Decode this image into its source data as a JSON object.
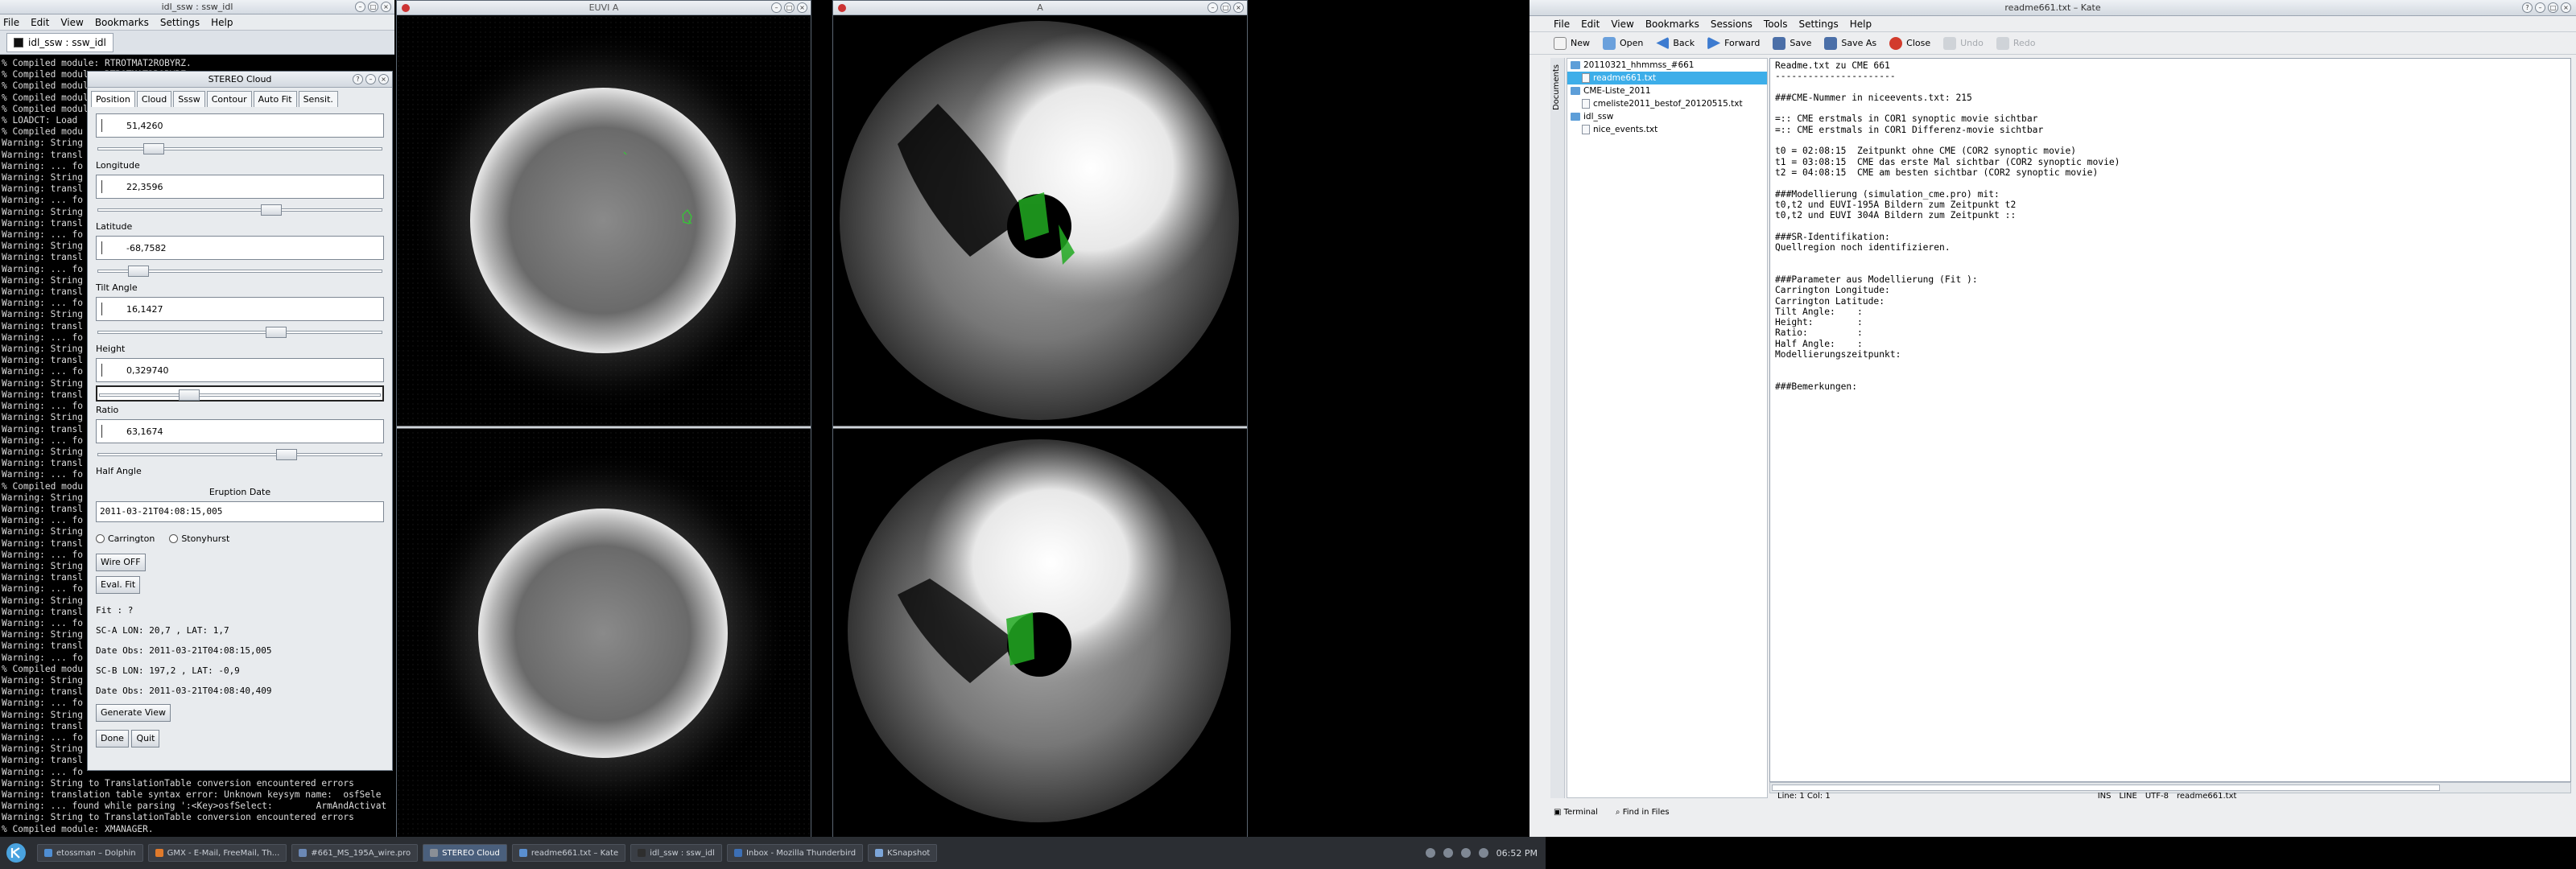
{
  "terminal": {
    "title": "idl_ssw : ssw_idl",
    "menu": [
      "File",
      "Edit",
      "View",
      "Bookmarks",
      "Settings",
      "Help"
    ],
    "tab_label": "idl_ssw : ssw_idl",
    "lines": [
      "% Compiled module: RTROTMAT2ROBYRZ.",
      "% Compiled module: RTROTMAT2ROBYRZ.",
      "% Compiled module: ",
      "% Compiled module: ",
      "% Compiled module: ",
      "% LOADCT: Load",
      "% Compiled modu",
      "Warning: String",
      "Warning: transl",
      "Warning: ... fo",
      "Warning: String",
      "Warning: transl",
      "Warning: ... fo",
      "Warning: String",
      "Warning: transl",
      "Warning: ... fo",
      "Warning: String",
      "Warning: transl",
      "Warning: ... fo",
      "Warning: String",
      "Warning: transl",
      "Warning: ... fo",
      "Warning: String",
      "Warning: transl",
      "Warning: ... fo",
      "Warning: String",
      "Warning: transl",
      "Warning: ... fo",
      "Warning: String",
      "Warning: transl",
      "Warning: ... fo",
      "Warning: String",
      "Warning: transl",
      "Warning: ... fo",
      "Warning: String",
      "Warning: transl",
      "Warning: ... fo",
      "% Compiled modu",
      "Warning: String",
      "Warning: transl",
      "Warning: ... fo",
      "Warning: String",
      "Warning: transl",
      "Warning: ... fo",
      "Warning: String",
      "Warning: transl",
      "Warning: ... fo",
      "Warning: String",
      "Warning: transl",
      "Warning: ... fo",
      "Warning: String",
      "Warning: transl",
      "Warning: ... fo",
      "% Compiled modu",
      "Warning: String",
      "Warning: transl",
      "Warning: ... fo",
      "Warning: String",
      "Warning: transl",
      "Warning: ... fo",
      "Warning: String",
      "Warning: transl",
      "Warning: ... fo",
      "Warning: String to TranslationTable conversion encountered errors",
      "Warning: translation table syntax error: Unknown keysym name:  osfSele",
      "Warning: ... found while parsing ':<Key>osfSelect:        ArmAndActivat",
      "Warning: String to TranslationTable conversion encountered errors",
      "% Compiled module: XMANAGER."
    ]
  },
  "dialog": {
    "title": "STEREO Cloud",
    "tabs": [
      "Position",
      "Cloud",
      "Sssw",
      "Contour",
      "Auto Fit",
      "Sensit."
    ],
    "fields": [
      {
        "value": "51,4260",
        "label": "Longitude",
        "slider_pos": 0.18,
        "boxed": false
      },
      {
        "value": "22,3596",
        "label": "Latitude",
        "slider_pos": 0.62,
        "boxed": false
      },
      {
        "value": "-68,7582",
        "label": "Tilt Angle",
        "slider_pos": 0.12,
        "boxed": false
      },
      {
        "value": "16,1427",
        "label": "Height",
        "slider_pos": 0.64,
        "boxed": false
      },
      {
        "value": "0,329740",
        "label": "Ratio",
        "slider_pos": 0.31,
        "boxed": true
      },
      {
        "value": "63,1674",
        "label": "Half Angle",
        "slider_pos": 0.68,
        "boxed": false
      }
    ],
    "eruption_label": "Eruption Date",
    "eruption_date": "2011-03-21T04:08:15,005",
    "radio_carrington": "Carrington",
    "radio_stonyhurst": "Stonyhurst",
    "wire_btn": "Wire OFF",
    "eval_btn": "Eval. Fit",
    "fit_text": "Fit : ?",
    "sca_lon": "SC-A LON:   20,7 , LAT:   1,7",
    "sca_date": "Date Obs: 2011-03-21T04:08:15,005",
    "scb_lon": "SC-B LON:  197,2 , LAT:  -0,9",
    "scb_date": "Date Obs: 2011-03-21T04:08:40,409",
    "generate_btn": "Generate View",
    "done_btn": "Done",
    "quit_btn": "Quit"
  },
  "image_windows": {
    "left_title": "EUVI A",
    "right_title": "A"
  },
  "kate": {
    "title": "readme661.txt – Kate",
    "menu": [
      "File",
      "Edit",
      "View",
      "Bookmarks",
      "Sessions",
      "Tools",
      "Settings",
      "Help"
    ],
    "toolbar": {
      "new": "New",
      "open": "Open",
      "back": "Back",
      "forward": "Forward",
      "save": "Save",
      "save_as": "Save As",
      "close": "Close",
      "undo": "Undo",
      "redo": "Redo"
    },
    "side_tab": "Documents",
    "tree": [
      {
        "label": "20110321_hhmmss_#661",
        "type": "folder",
        "indent": 0,
        "sel": false
      },
      {
        "label": "readme661.txt",
        "type": "file",
        "indent": 1,
        "sel": true
      },
      {
        "label": "CME-Liste_2011",
        "type": "folder",
        "indent": 0,
        "sel": false
      },
      {
        "label": "cmeliste2011_bestof_20120515.txt",
        "type": "file",
        "indent": 1,
        "sel": false
      },
      {
        "label": "idl_ssw",
        "type": "folder",
        "indent": 0,
        "sel": false
      },
      {
        "label": "nice_events.txt",
        "type": "file",
        "indent": 1,
        "sel": false
      }
    ],
    "editor_lines": [
      "Readme.txt zu CME 661",
      "----------------------",
      "",
      "###CME-Nummer in niceevents.txt: 215",
      "",
      "=:: CME erstmals in COR1 synoptic movie sichtbar",
      "=:: CME erstmals in COR1 Differenz-movie sichtbar",
      "",
      "t0 = 02:08:15  Zeitpunkt ohne CME (COR2 synoptic movie)",
      "t1 = 03:08:15  CME das erste Mal sichtbar (COR2 synoptic movie)",
      "t2 = 04:08:15  CME am besten sichtbar (COR2 synoptic movie)",
      "",
      "###Modellierung (simulation_cme.pro) mit:",
      "t0,t2 und EUVI-195A Bildern zum Zeitpunkt t2",
      "t0,t2 und EUVI 304A Bildern zum Zeitpunkt ::",
      "",
      "###SR-Identifikation:",
      "Quellregion noch identifizieren.",
      "",
      "",
      "###Parameter aus Modellierung (Fit ):",
      "Carrington Longitude:",
      "Carrington Latitude:",
      "Tilt Angle:    :",
      "Height:        :",
      "Ratio:         :",
      "Half Angle:    :",
      "Modellierungszeitpunkt:",
      "",
      "",
      "###Bemerkungen:"
    ],
    "status_pos": "Line: 1 Col: 1",
    "status_ins": "INS",
    "status_line": "LINE",
    "status_enc": "UTF-8",
    "status_file": "readme661.txt",
    "bottom_terminal": "Terminal",
    "bottom_find": "Find in Files"
  },
  "taskbar": {
    "tasks": [
      {
        "label": "etossman – Dolphin",
        "color": "#4f8ed3",
        "active": false
      },
      {
        "label": "GMX - E-Mail, FreeMail, Th...",
        "color": "#e07a2b",
        "active": false
      },
      {
        "label": "#661_MS_195A_wire.pro",
        "color": "#6b88b5",
        "active": false
      },
      {
        "label": "STEREO Cloud",
        "color": "#8a8f96",
        "active": true
      },
      {
        "label": "readme661.txt – Kate",
        "color": "#5a8fd0",
        "active": false
      },
      {
        "label": "idl_ssw : ssw_idl",
        "color": "#2e2e2e",
        "active": false
      },
      {
        "label": "Inbox - Mozilla Thunderbird",
        "color": "#3c6fb5",
        "active": false
      },
      {
        "label": "KSnapshot",
        "color": "#7ca5d8",
        "active": false
      }
    ],
    "clock": "06:52 PM"
  }
}
